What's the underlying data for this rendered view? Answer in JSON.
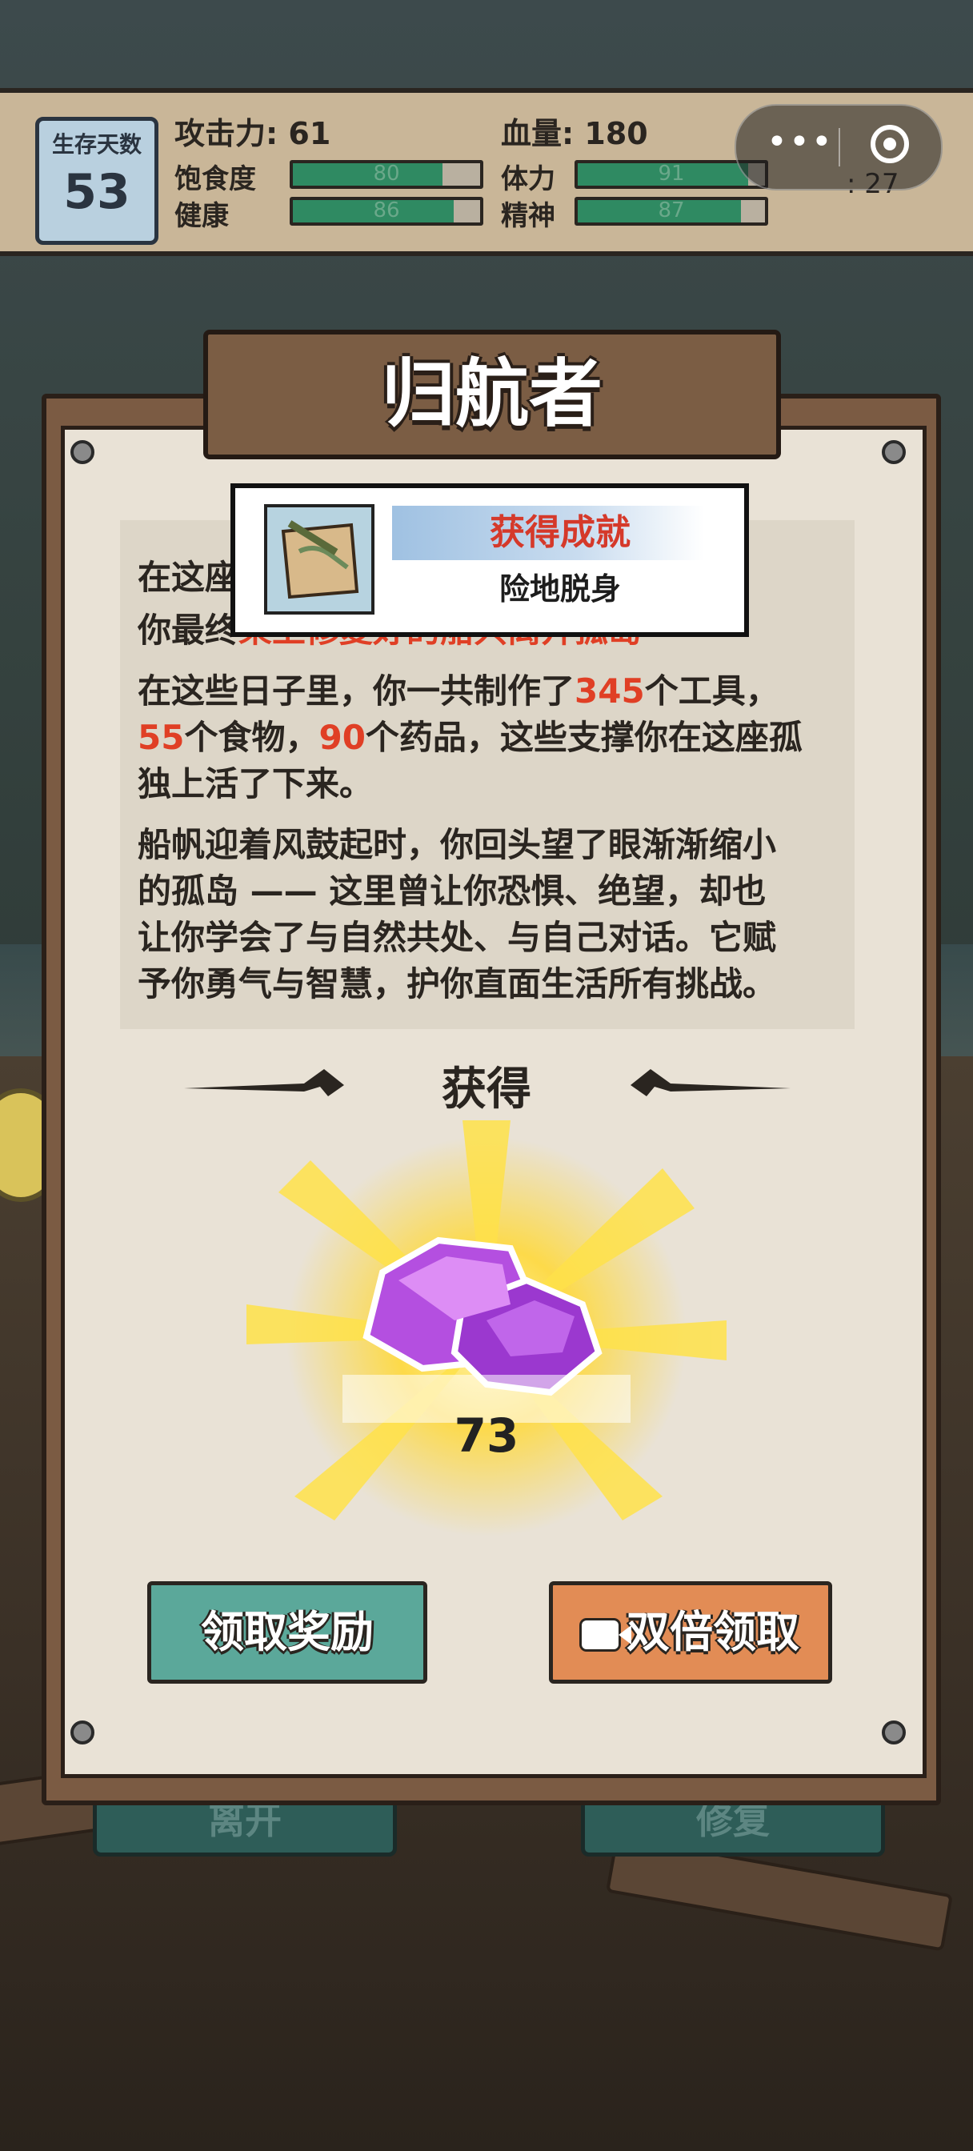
{
  "status": {
    "days_label": "生存天数",
    "days_value": "53",
    "attack": "攻击力: 61",
    "hp": "血量: 180",
    "satiety": {
      "label": "饱食度",
      "value": 80
    },
    "health": {
      "label": "健康",
      "value": 86
    },
    "stamina": {
      "label": "体力",
      "value": 91
    },
    "spirit": {
      "label": "精神",
      "value": 87
    },
    "temperature": ": 27"
  },
  "dialog": {
    "title": "归航者",
    "achievement": {
      "header": "获得成就",
      "name": "险地脱身"
    },
    "story": {
      "l1": "在这座",
      "l2a": "你最终",
      "l2b": "乘上修复好的船只离开孤岛",
      "l3a": "在这些日子里，你一共制作了",
      "tools": "345",
      "l3b": "个工具，",
      "foods": "55",
      "l4a": "个食物，",
      "medicine": "90",
      "l4b": "个药品，这些支撑你在这座孤",
      "l5": "独上活了下来。",
      "l6": "船帆迎着风鼓起时，你回头望了眼渐渐缩小",
      "l7": "的孤岛 —— 这里曾让你恐惧、绝望，却也",
      "l8": "让你学会了与自然共处、与自己对话。它赋",
      "l9": "予你勇气与智慧，护你直面生活所有挑战。"
    },
    "obtain_label": "获得",
    "reward_count": "73",
    "claim_button": "领取奖励",
    "double_button": "双倍领取"
  },
  "background": {
    "btn_left": "离开",
    "btn_right": "修复"
  },
  "colors": {
    "highlight": "#e03f25",
    "claim": "#5ba89a",
    "double": "#e28c55",
    "gem": "#b44fe0"
  }
}
